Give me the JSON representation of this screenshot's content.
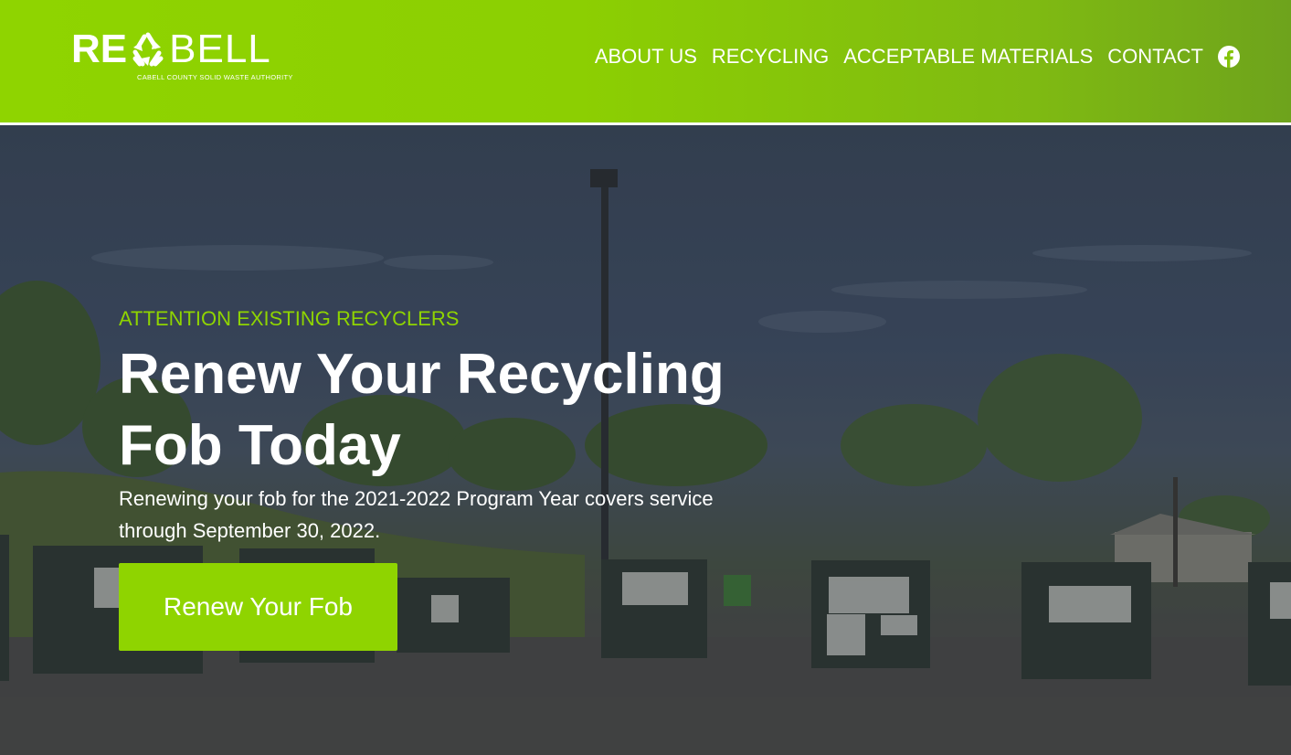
{
  "header": {
    "logo": {
      "text_left": "RE",
      "text_right": "BELL",
      "tagline": "CABELL COUNTY SOLID WASTE AUTHORITY",
      "mark_icon": "recycle-icon"
    },
    "nav": [
      {
        "label": "ABOUT US"
      },
      {
        "label": "RECYCLING"
      },
      {
        "label": "ACCEPTABLE MATERIALS"
      },
      {
        "label": "CONTACT"
      }
    ],
    "social_icon": "facebook-icon"
  },
  "hero": {
    "kicker": "ATTENTION EXISTING RECYCLERS",
    "headline": "Renew Your Recycling Fob Today",
    "subtext": "Renewing your fob for the 2021-2022 Program Year covers service through September 30, 2022.",
    "cta_label": "Renew Your Fob"
  },
  "colors": {
    "brand_green": "#8fd400",
    "header_gradient_end": "#6ea31c",
    "text_light": "#ffffff"
  }
}
